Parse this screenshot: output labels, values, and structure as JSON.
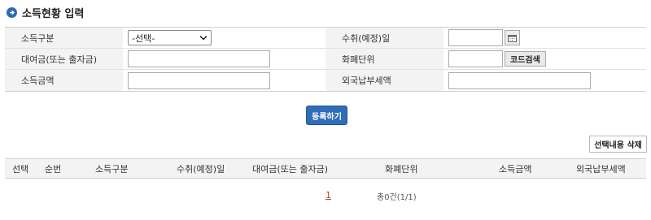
{
  "section": {
    "title": "소득현황 입력"
  },
  "form": {
    "income_type_label": "소득구분",
    "income_type_value": "-선택-",
    "receive_date_label": "수취(예정)일",
    "receive_date_value": "",
    "loan_label": "대여금(또는 출자금)",
    "loan_value": "",
    "currency_label": "화폐단위",
    "currency_value": "",
    "code_search_label": "코드검색",
    "income_amount_label": "소득금액",
    "income_amount_value": "",
    "foreign_tax_label": "외국납부세액",
    "foreign_tax_value": ""
  },
  "actions": {
    "register_label": "등록하기",
    "delete_selected_label": "선택내용 삭제"
  },
  "table": {
    "headers": [
      "선택",
      "순번",
      "소득구분",
      "수취(예정)일",
      "대여금(또는 출자금)",
      "화폐단위",
      "소득금액",
      "외국납부세액"
    ]
  },
  "pagination": {
    "current_page": "1",
    "total_text": "총0건(1/1)"
  },
  "colors": {
    "accent": "#2f6db8",
    "title_icon": "#2a6bb3",
    "page_link": "#c0392b"
  },
  "icons": {
    "title": "arrow-right-circle-icon",
    "select": "chevron-down-icon",
    "calendar": "calendar-icon"
  }
}
